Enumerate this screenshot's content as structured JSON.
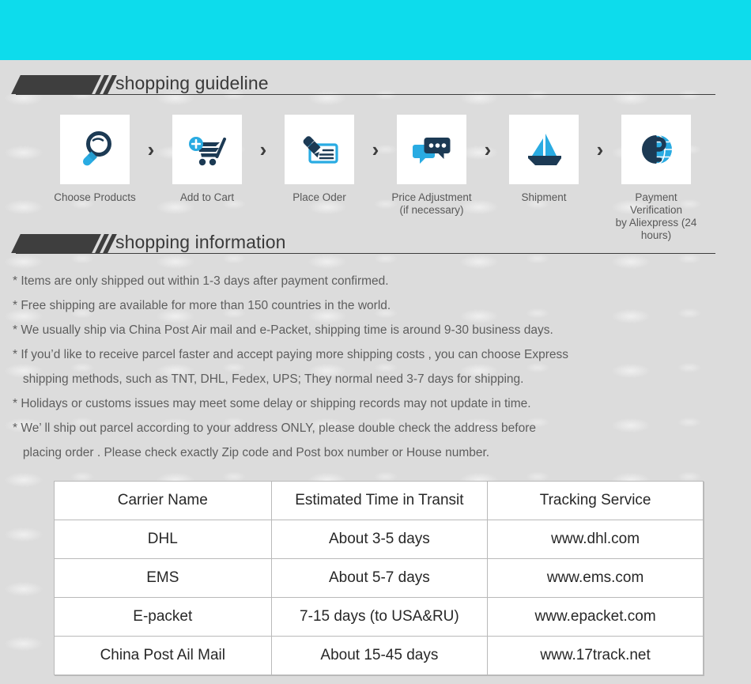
{
  "colors": {
    "banner": "#0ddcec",
    "page_bg": "#dcdcdc",
    "icon_dark": "#1c3a54",
    "icon_blue": "#29abe2",
    "heading_text": "#3a3a3a",
    "body_text": "#5e5e5e",
    "table_border": "#b9b9b9"
  },
  "sections": {
    "guideline": {
      "title": "shopping guideline"
    },
    "information": {
      "title": "shopping information"
    }
  },
  "steps": [
    {
      "label": "Choose Products",
      "icon": "magnifier-icon"
    },
    {
      "label": "Add to Cart",
      "icon": "shopping-cart-plus-icon"
    },
    {
      "label": "Place Oder",
      "icon": "pen-check-icon"
    },
    {
      "label": "Price Adjustment\n(if necessary)",
      "icon": "chat-bubbles-icon"
    },
    {
      "label": "Shipment",
      "icon": "sailboat-icon"
    },
    {
      "label": "Payment Verification\nby  Aliexpress (24 hours)",
      "icon": "dollar-globe-icon"
    }
  ],
  "step_separator": "›",
  "info_lines": [
    "* Items are only shipped out within 1-3 days after payment confirmed.",
    "* Free shipping are available for more than 150 countries in the world.",
    "* We usually ship via China Post Air mail and e-Packet, shipping time is around 9-30 business days.",
    "* If you’d like to receive parcel faster and accept paying more shipping costs , you can choose Express",
    "   shipping methods, such as TNT, DHL, Fedex, UPS; They normal need 3-7 days for shipping.",
    "* Holidays or customs issues may meet some delay or shipping records may not update in time.",
    "* We’ ll ship out parcel according to your address ONLY, please double check the address before",
    "   placing order . Please check exactly Zip code and Post box number or House number."
  ],
  "carrier_table": {
    "headers": [
      "Carrier Name",
      "Estimated Time in Transit",
      "Tracking Service"
    ],
    "rows": [
      [
        "DHL",
        "About 3-5 days",
        "www.dhl.com"
      ],
      [
        "EMS",
        "About 5-7 days",
        "www.ems.com"
      ],
      [
        "E-packet",
        "7-15 days (to USA&RU)",
        "www.epacket.com"
      ],
      [
        "China Post Ail Mail",
        "About 15-45 days",
        "www.17track.net"
      ]
    ]
  }
}
